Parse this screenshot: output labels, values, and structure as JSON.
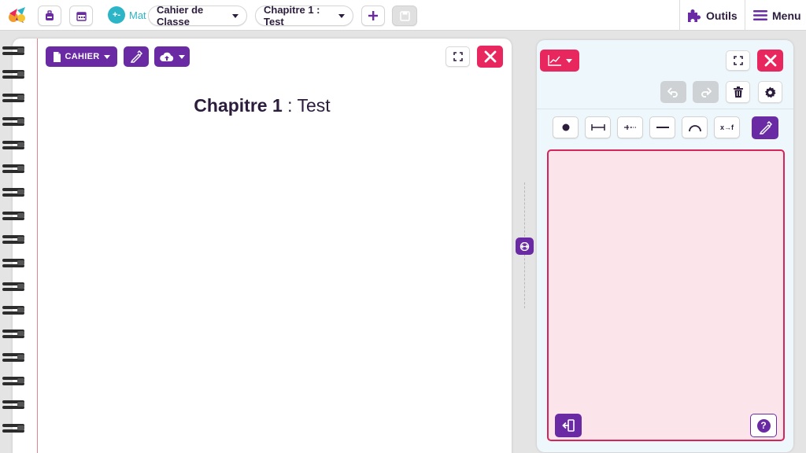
{
  "topbar": {
    "icons": [
      "app-logo",
      "backpack-icon",
      "calendar-icon",
      "save-icon",
      "plus-icon"
    ],
    "subject_label": "Mat",
    "subject_icon_text": "+-",
    "cahier_select": "Cahier de Classe",
    "chapter_select": "Chapitre 1 : Test",
    "outils_label": "Outils",
    "menu_label": "Menu"
  },
  "notebook": {
    "cahier_button": "CAHIER",
    "title_bold": "Chapitre 1",
    "title_rest": " : Test"
  },
  "graph_panel": {
    "tools": [
      "point-icon",
      "segment-icon",
      "half-line-icon",
      "line-icon",
      "arc-icon",
      "function-icon",
      "pencil-icon"
    ],
    "function_tool_label": "x→f",
    "help_label": "?"
  },
  "colors": {
    "purple": "#6a2aa3",
    "pink": "#e8275f",
    "teal": "#2bb5c6",
    "canvas_bg": "#fbe4ea"
  }
}
